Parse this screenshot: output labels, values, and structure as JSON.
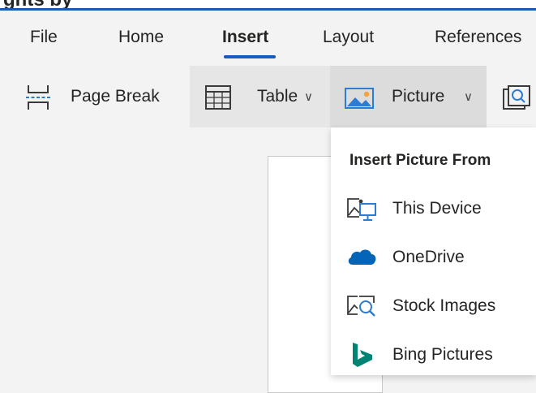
{
  "document": {
    "title_fragment": "ghts by"
  },
  "tabs": [
    {
      "label": "File"
    },
    {
      "label": "Home"
    },
    {
      "label": "Insert",
      "active": true
    },
    {
      "label": "Layout"
    },
    {
      "label": "References"
    }
  ],
  "ribbon": {
    "page_break": {
      "label": "Page Break"
    },
    "table": {
      "label": "Table",
      "chevron": "∨"
    },
    "picture": {
      "label": "Picture",
      "chevron": "∨"
    }
  },
  "picture_menu": {
    "header": "Insert Picture From",
    "items": [
      {
        "label": "This Device",
        "icon": "device-picture-icon"
      },
      {
        "label": "OneDrive",
        "icon": "onedrive-cloud-icon"
      },
      {
        "label": "Stock Images",
        "icon": "stock-images-icon"
      },
      {
        "label": "Bing Pictures",
        "icon": "bing-logo-icon"
      }
    ]
  },
  "colors": {
    "accent": "#185abd",
    "onedrive": "#0364b8",
    "bing": "#008373",
    "icon_blue": "#2b7cd3"
  }
}
